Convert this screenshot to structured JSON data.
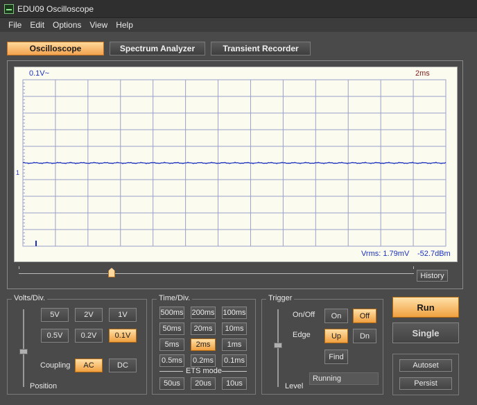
{
  "window": {
    "title": "EDU09 Oscilloscope"
  },
  "menu": [
    "File",
    "Edit",
    "Options",
    "View",
    "Help"
  ],
  "tabs": [
    {
      "label": "Oscilloscope",
      "active": true
    },
    {
      "label": "Spectrum Analyzer",
      "active": false
    },
    {
      "label": "Transient Recorder",
      "active": false
    }
  ],
  "screen": {
    "volts_label": "0.1V~",
    "time_label": "2ms",
    "channel_marker": "1",
    "vrms": "Vrms: 1.79mV",
    "dbm": "-52.7dBm",
    "trace_color": "#1a2fbf",
    "grid_color": "#9aa0c8"
  },
  "history_button": "History",
  "volts_div": {
    "title": "Volts/Div.",
    "buttons": [
      {
        "label": "5V",
        "selected": false
      },
      {
        "label": "2V",
        "selected": false
      },
      {
        "label": "1V",
        "selected": false
      },
      {
        "label": "0.5V",
        "selected": false
      },
      {
        "label": "0.2V",
        "selected": false
      },
      {
        "label": "0.1V",
        "selected": true
      }
    ],
    "coupling_label": "Coupling",
    "coupling": [
      {
        "label": "AC",
        "selected": true
      },
      {
        "label": "DC",
        "selected": false
      }
    ],
    "position_label": "Position"
  },
  "time_div": {
    "title": "Time/Div.",
    "buttons": [
      {
        "label": "500ms",
        "selected": false
      },
      {
        "label": "200ms",
        "selected": false
      },
      {
        "label": "100ms",
        "selected": false
      },
      {
        "label": "50ms",
        "selected": false
      },
      {
        "label": "20ms",
        "selected": false
      },
      {
        "label": "10ms",
        "selected": false
      },
      {
        "label": "5ms",
        "selected": false
      },
      {
        "label": "2ms",
        "selected": true
      },
      {
        "label": "1ms",
        "selected": false
      },
      {
        "label": "0.5ms",
        "selected": false
      },
      {
        "label": "0.2ms",
        "selected": false
      },
      {
        "label": "0.1ms",
        "selected": false
      }
    ],
    "ets_label": "ETS mode",
    "ets_buttons": [
      {
        "label": "50us",
        "selected": false
      },
      {
        "label": "20us",
        "selected": false
      },
      {
        "label": "10us",
        "selected": false
      }
    ]
  },
  "trigger": {
    "title": "Trigger",
    "onoff_label": "On/Off",
    "on": "On",
    "off": "Off",
    "off_selected": true,
    "edge_label": "Edge",
    "up": "Up",
    "dn": "Dn",
    "up_selected": true,
    "find": "Find",
    "level_label": "Level",
    "status": "Running"
  },
  "run": "Run",
  "single": "Single",
  "autoset": "Autoset",
  "persist": "Persist"
}
